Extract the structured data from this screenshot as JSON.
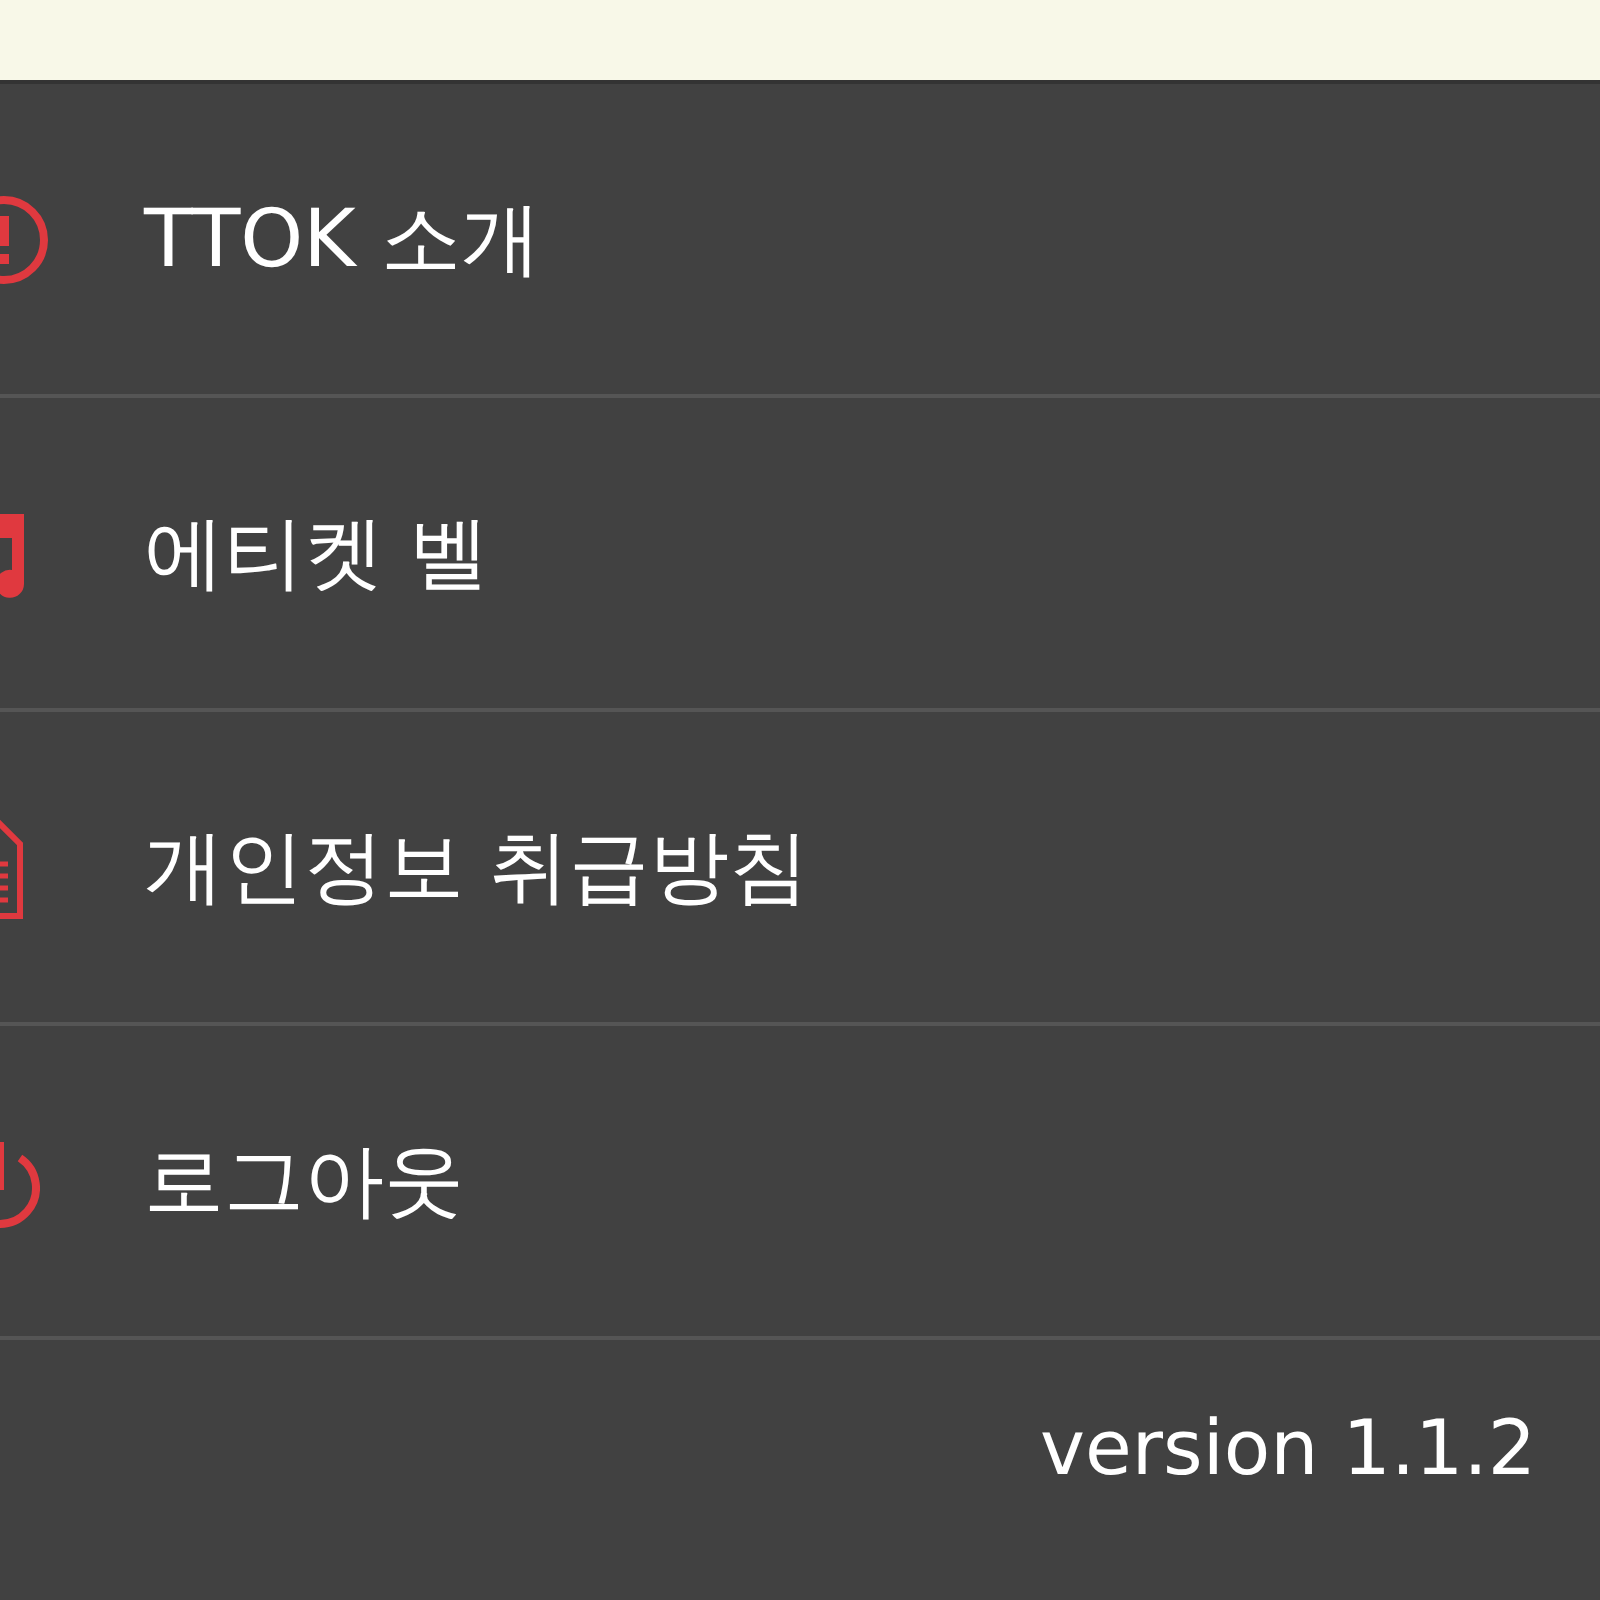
{
  "menu": [
    {
      "label": "TTOK 소개",
      "kind": "info"
    },
    {
      "label": "에티켓 벨",
      "kind": "music"
    },
    {
      "label": "개인정보 취급방침",
      "kind": "document"
    },
    {
      "label": "로그아웃",
      "kind": "power"
    }
  ],
  "version": "version 1.1.2"
}
